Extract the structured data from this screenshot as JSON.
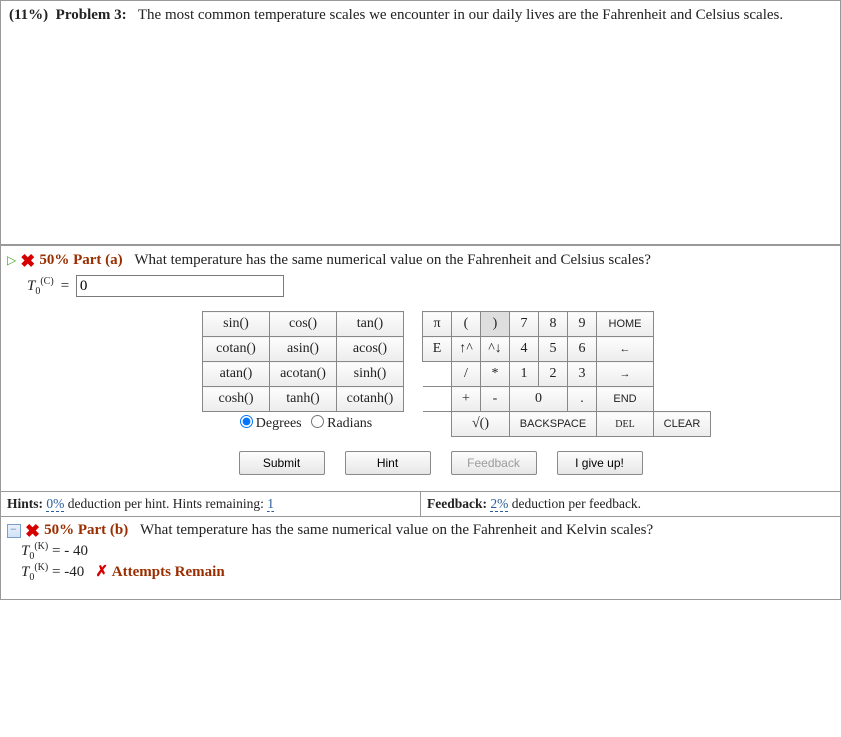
{
  "problem": {
    "weight": "(11%)",
    "label": "Problem 3:",
    "statement": "The most common temperature scales we encounter in our daily lives are the Fahrenheit and Celsius scales."
  },
  "partA": {
    "weight_label": "50% Part (a)",
    "question": "What temperature has the same numerical value on the Fahrenheit and Celsius scales?",
    "var_symbol": "T",
    "var_sub": "0",
    "var_sup": "(C)",
    "equals": "=",
    "input_value": "0"
  },
  "keypad": {
    "fn": {
      "r1c1": "sin()",
      "r1c2": "cos()",
      "r1c3": "tan()",
      "r2c1": "cotan()",
      "r2c2": "asin()",
      "r2c3": "acos()",
      "r3c1": "atan()",
      "r3c2": "acotan()",
      "r3c3": "sinh()",
      "r4c1": "cosh()",
      "r4c2": "tanh()",
      "r4c3": "cotanh()"
    },
    "mode": {
      "degrees": "Degrees",
      "radians": "Radians"
    },
    "num": {
      "pi": "π",
      "lp": "(",
      "rp": ")",
      "n7": "7",
      "n8": "8",
      "n9": "9",
      "home": "HOME",
      "E": "E",
      "up": "↑^",
      "dn": "^↓",
      "n4": "4",
      "n5": "5",
      "n6": "6",
      "left": "←",
      "slash": "/",
      "star": "*",
      "n1": "1",
      "n2": "2",
      "n3": "3",
      "right": "→",
      "plus": "+",
      "minus": "-",
      "n0": "0",
      "dot": ".",
      "end": "END",
      "sqrt": "√()",
      "bksp": "BACKSPACE",
      "del": "DEL",
      "clear": "CLEAR"
    }
  },
  "actions": {
    "submit": "Submit",
    "hint": "Hint",
    "feedback": "Feedback",
    "giveup": "I give up!"
  },
  "hints": {
    "left_prefix": "Hints:",
    "left_pct": "0%",
    "left_mid": "deduction per hint. Hints remaining:",
    "left_remaining": "1",
    "right_prefix": "Feedback:",
    "right_pct": "2%",
    "right_suffix": "deduction per feedback."
  },
  "partB": {
    "weight_label": "50% Part (b)",
    "question": "What temperature has the same numerical value on the Fahrenheit and Kelvin scales?",
    "line1_var": "T",
    "line1_sub": "0",
    "line1_sup": "(K)",
    "line1_rest": " = - 40",
    "line2_var": "T",
    "line2_sub": "0",
    "line2_sup": "(K)",
    "line2_rest": " = -40",
    "x": "✗",
    "attempts": "Attempts Remain"
  }
}
